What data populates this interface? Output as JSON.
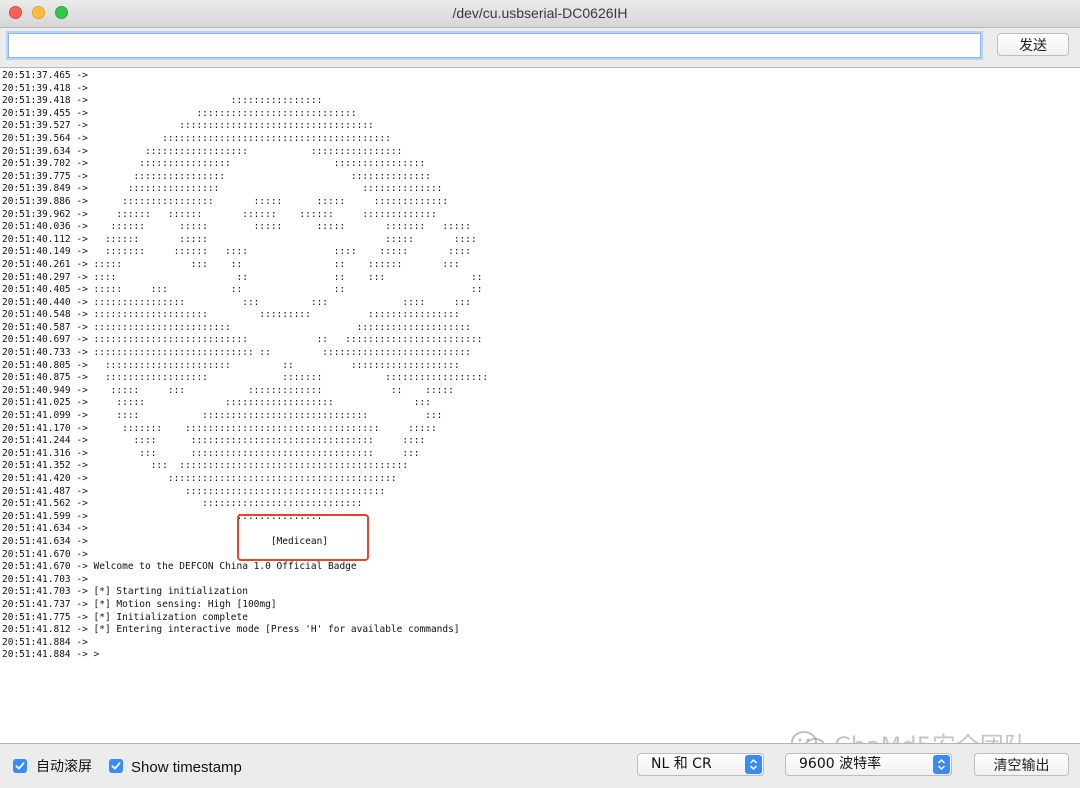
{
  "window": {
    "title": "/dev/cu.usbserial-DC0626IH"
  },
  "input": {
    "value": "",
    "placeholder": ""
  },
  "toolbar": {
    "send_label": "发送"
  },
  "log_lines": [
    "20:51:37.465 -> ",
    "20:51:39.418 -> ",
    "20:51:39.418 ->                         ::::::::::::::::",
    "20:51:39.455 ->                   ::::::::::::::::::::::::::::",
    "20:51:39.527 ->                ::::::::::::::::::::::::::::::::::",
    "20:51:39.564 ->             ::::::::::::::::::::::::::::::::::::::::",
    "20:51:39.634 ->          ::::::::::::::::::           ::::::::::::::::",
    "20:51:39.702 ->         ::::::::::::::::                  ::::::::::::::::",
    "20:51:39.775 ->        ::::::::::::::::                      ::::::::::::::",
    "20:51:39.849 ->       ::::::::::::::::                         ::::::::::::::",
    "20:51:39.886 ->      ::::::::::::::::       :::::      :::::     :::::::::::::",
    "20:51:39.962 ->     ::::::   ::::::       ::::::    ::::::     :::::::::::::",
    "20:51:40.036 ->    ::::::      :::::        :::::      :::::       :::::::   :::::",
    "20:51:40.112 ->   ::::::       :::::                               :::::       ::::",
    "20:51:40.149 ->   :::::::     ::::::   ::::               ::::    :::::       ::::",
    "20:51:40.261 -> :::::            :::    ::                ::    ::::::       :::",
    "20:51:40.297 -> ::::                     ::               ::    :::               ::",
    "20:51:40.405 -> :::::     :::           ::                ::                      ::",
    "20:51:40.440 -> ::::::::::::::::          :::         :::             ::::     :::",
    "20:51:40.548 -> ::::::::::::::::::::         :::::::::          ::::::::::::::::",
    "20:51:40.587 -> ::::::::::::::::::::::::                      ::::::::::::::::::::",
    "20:51:40.697 -> :::::::::::::::::::::::::::            ::   ::::::::::::::::::::::::",
    "20:51:40.733 -> :::::::::::::::::::::::::::: ::         ::::::::::::::::::::::::::",
    "20:51:40.805 ->   ::::::::::::::::::::::         ::          :::::::::::::::::::",
    "20:51:40.875 ->   ::::::::::::::::::             :::::::           ::::::::::::::::::",
    "20:51:40.949 ->    :::::     :::           :::::::::::::            ::    :::::",
    "20:51:41.025 ->     :::::              :::::::::::::::::::              :::",
    "20:51:41.099 ->     ::::           :::::::::::::::::::::::::::::          :::",
    "20:51:41.170 ->      :::::::    ::::::::::::::::::::::::::::::::::     :::::",
    "20:51:41.244 ->        ::::      ::::::::::::::::::::::::::::::::     ::::",
    "20:51:41.316 ->         :::      ::::::::::::::::::::::::::::::::     :::",
    "20:51:41.352 ->           :::  ::::::::::::::::::::::::::::::::::::::::",
    "20:51:41.420 ->              ::::::::::::::::::::::::::::::::::::::::",
    "20:51:41.487 ->                 :::::::::::::::::::::::::::::::::::",
    "20:51:41.562 ->                    ::::::::::::::::::::::::::::",
    "20:51:41.599 ->                          :::::::::::::::",
    "20:51:41.634 -> ",
    "20:51:41.634 ->                                [Medicean]",
    "20:51:41.670 -> ",
    "20:51:41.670 -> Welcome to the DEFCON China 1.0 Official Badge",
    "20:51:41.703 -> ",
    "20:51:41.703 -> [*] Starting initialization",
    "20:51:41.737 -> [*] Motion sensing: High [100mg]",
    "20:51:41.775 -> [*] Initialization complete",
    "20:51:41.812 -> [*] Entering interactive mode [Press 'H' for available commands]",
    "20:51:41.884 -> ",
    "20:51:41.884 -> >"
  ],
  "watermark": {
    "text": "ChaMd5安全团队",
    "icon": "wechat-icon"
  },
  "footer": {
    "autoscroll": {
      "label": "自动滚屏",
      "checked": true
    },
    "show_timestamp": {
      "label": "Show timestamp",
      "checked": true
    },
    "line_ending": {
      "value": "NL 和 CR"
    },
    "baud_rate": {
      "value": "9600 波特率"
    },
    "clear_label": "清空输出"
  },
  "colors": {
    "accent": "#3b8af5",
    "highlight": "#e0462e"
  }
}
